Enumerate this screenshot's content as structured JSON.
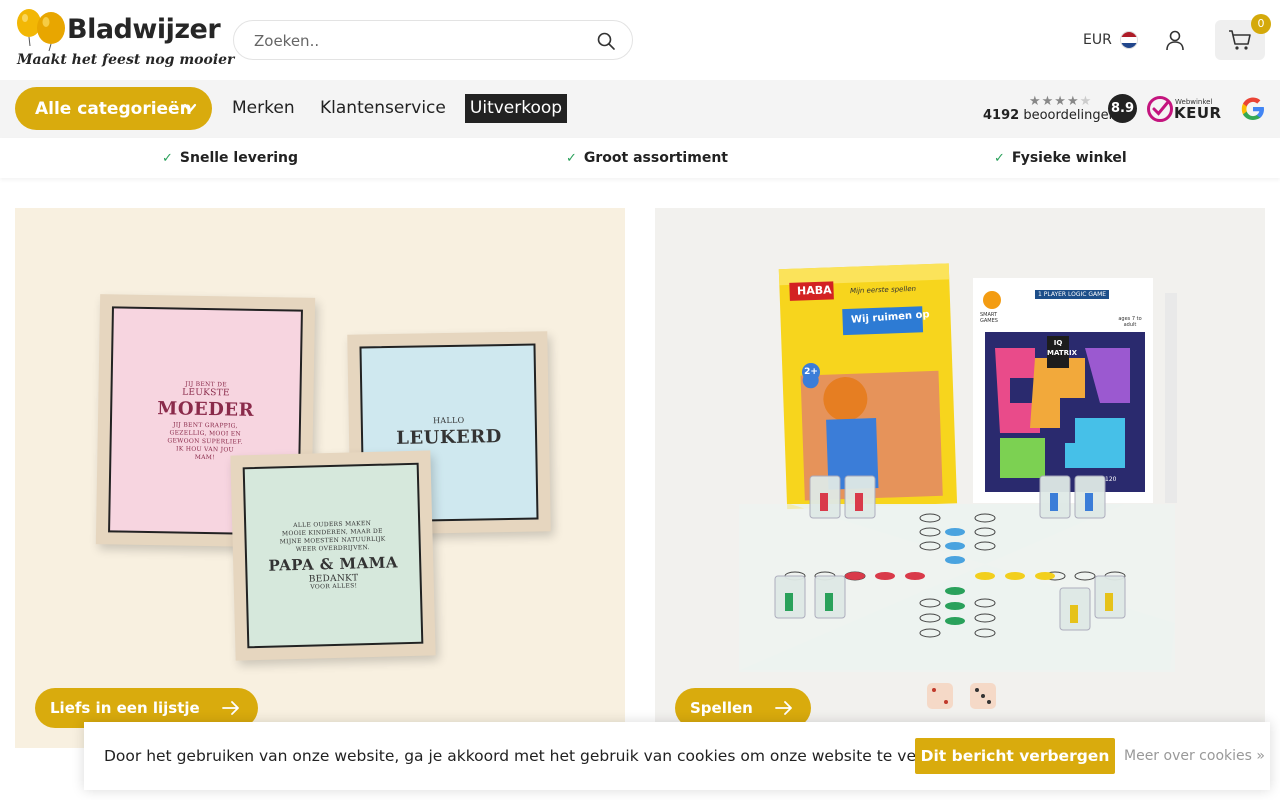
{
  "header": {
    "brand": "Bladwijzer",
    "tagline": "Maakt het feest nog mooier",
    "search_placeholder": "Zoeken..",
    "currency": "EUR",
    "cart_count": "0",
    "colors": {
      "accent": "#d9ab0d",
      "dark": "#222222"
    }
  },
  "nav": {
    "categories_label": "Alle categorieën",
    "links": [
      "Merken",
      "Klantenservice"
    ],
    "sale_label": "Uitverkoop",
    "reviews": {
      "stars": "★★★★★",
      "count": "4192",
      "count_label": "beoordelingen",
      "score": "8.9"
    },
    "keur": {
      "small": "Webwinkel",
      "big": "KEUR"
    }
  },
  "usps": [
    "Snelle levering",
    "Groot assortiment",
    "Fysieke winkel"
  ],
  "banners": [
    {
      "button_label": "Liefs in een lijstje",
      "frames": [
        {
          "lines": [
            "JIJ BENT DE",
            "LEUKSTE"
          ],
          "big": "MOEDER",
          "tail": [
            "JIJ BENT GRAPPIG,",
            "GEZELLIG, MOOI EN",
            "GEWOON SUPERLIEF.",
            "IK HOU VAN JOU",
            "MAM!"
          ]
        },
        {
          "lines": [
            "HALLO"
          ],
          "big": "LEUKERD",
          "tail": []
        },
        {
          "lines": [
            "ALLE OUDERS MAKEN",
            "MOOIE KINDEREN, MAAR DE",
            "MIJNE MOESTEN NATUURLIJK",
            "WEER OVERDRIJVEN."
          ],
          "big": "PAPA & MAMA",
          "tail": [
            "BEDANKT",
            "VOOR ALLES!"
          ]
        }
      ]
    },
    {
      "button_label": "Spellen",
      "game_box_1": {
        "brand": "HABA",
        "series": "Mijn eerste spellen",
        "title": "Wij ruimen op",
        "age": "2+"
      },
      "game_box_2": {
        "brand": "SMART GAMES",
        "title": "IQ MATRIX",
        "subtitle": "1 PLAYER LOGIC GAME",
        "age": "ages 7 to adult",
        "count": "120"
      }
    }
  ],
  "cookie": {
    "message": "Door het gebruiken van onze website, ga je akkoord met het gebruik van cookies om onze website te verbeteren.",
    "hide_label": "Dit bericht verbergen",
    "more_label": "Meer over cookies »"
  }
}
